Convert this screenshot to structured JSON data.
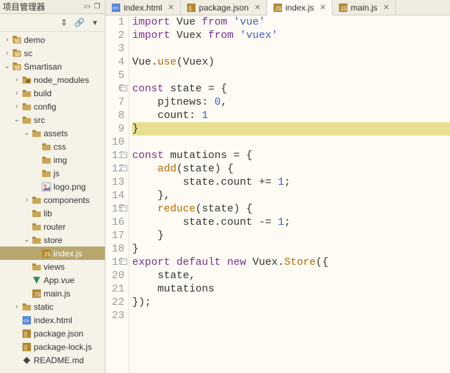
{
  "sidebar": {
    "title": "项目管理器",
    "toolbar": {
      "collapse": "⇕",
      "link": "🔗",
      "menu": "▾"
    },
    "win": {
      "min": "▭",
      "max": "❐",
      "close": "✕"
    }
  },
  "tree": [
    {
      "d": 0,
      "caret": "›",
      "icon": "project",
      "label": "demo"
    },
    {
      "d": 0,
      "caret": "›",
      "icon": "project",
      "label": "sc"
    },
    {
      "d": 0,
      "caret": "⌄",
      "icon": "project",
      "label": "Smartisan"
    },
    {
      "d": 1,
      "caret": "›",
      "icon": "pkg",
      "label": "node_modules"
    },
    {
      "d": 1,
      "caret": "›",
      "icon": "fld",
      "label": "build"
    },
    {
      "d": 1,
      "caret": "›",
      "icon": "fld",
      "label": "config"
    },
    {
      "d": 1,
      "caret": "⌄",
      "icon": "fld",
      "label": "src"
    },
    {
      "d": 2,
      "caret": "⌄",
      "icon": "fld",
      "label": "assets"
    },
    {
      "d": 3,
      "caret": " ",
      "icon": "fld",
      "label": "css"
    },
    {
      "d": 3,
      "caret": " ",
      "icon": "fld",
      "label": "img"
    },
    {
      "d": 3,
      "caret": " ",
      "icon": "fld",
      "label": "js"
    },
    {
      "d": 3,
      "caret": " ",
      "icon": "png",
      "label": "logo.png"
    },
    {
      "d": 2,
      "caret": "›",
      "icon": "fld",
      "label": "components"
    },
    {
      "d": 2,
      "caret": " ",
      "icon": "fld",
      "label": "lib"
    },
    {
      "d": 2,
      "caret": " ",
      "icon": "fld",
      "label": "router"
    },
    {
      "d": 2,
      "caret": "⌄",
      "icon": "fld",
      "label": "store"
    },
    {
      "d": 3,
      "caret": " ",
      "icon": "js",
      "label": "index.js",
      "selected": true
    },
    {
      "d": 2,
      "caret": " ",
      "icon": "fld",
      "label": "views"
    },
    {
      "d": 2,
      "caret": " ",
      "icon": "vue",
      "label": "App.vue"
    },
    {
      "d": 2,
      "caret": " ",
      "icon": "js",
      "label": "main.js"
    },
    {
      "d": 1,
      "caret": "›",
      "icon": "fld",
      "label": "static"
    },
    {
      "d": 1,
      "caret": " ",
      "icon": "html",
      "label": "index.html"
    },
    {
      "d": 1,
      "caret": " ",
      "icon": "json",
      "label": "package.json"
    },
    {
      "d": 1,
      "caret": " ",
      "icon": "json",
      "label": "package-lock.js"
    },
    {
      "d": 1,
      "caret": " ",
      "icon": "md",
      "label": "README.md"
    }
  ],
  "tabs": [
    {
      "icon": "html",
      "label": "index.html",
      "active": false
    },
    {
      "icon": "json",
      "label": "package.json",
      "active": false
    },
    {
      "icon": "js",
      "label": "index.js",
      "active": true
    },
    {
      "icon": "js",
      "label": "main.js",
      "active": false
    }
  ],
  "code": [
    {
      "n": 1,
      "fold": "",
      "seg": [
        [
          "kw",
          "import"
        ],
        [
          "pln",
          " Vue "
        ],
        [
          "kw",
          "from"
        ],
        [
          "pln",
          " "
        ],
        [
          "str",
          "'vue'"
        ]
      ]
    },
    {
      "n": 2,
      "fold": "",
      "seg": [
        [
          "kw",
          "import"
        ],
        [
          "pln",
          " Vuex "
        ],
        [
          "kw",
          "from"
        ],
        [
          "pln",
          " "
        ],
        [
          "str",
          "'vuex'"
        ]
      ]
    },
    {
      "n": 3,
      "fold": "",
      "seg": []
    },
    {
      "n": 4,
      "fold": "",
      "seg": [
        [
          "id",
          "Vue"
        ],
        [
          "op",
          "."
        ],
        [
          "fn",
          "use"
        ],
        [
          "op",
          "("
        ],
        [
          "id",
          "Vuex"
        ],
        [
          "op",
          ")"
        ]
      ]
    },
    {
      "n": 5,
      "fold": "",
      "seg": []
    },
    {
      "n": 6,
      "fold": "−",
      "seg": [
        [
          "kw",
          "const"
        ],
        [
          "pln",
          " state "
        ],
        [
          "op",
          "= {"
        ]
      ]
    },
    {
      "n": 7,
      "fold": "",
      "seg": [
        [
          "pln",
          "    pjtnews: "
        ],
        [
          "num",
          "0"
        ],
        [
          "op",
          ","
        ]
      ]
    },
    {
      "n": 8,
      "fold": "",
      "seg": [
        [
          "pln",
          "    count: "
        ],
        [
          "num",
          "1"
        ]
      ]
    },
    {
      "n": 9,
      "fold": "",
      "hl": true,
      "seg": [
        [
          "op",
          "}"
        ]
      ]
    },
    {
      "n": 10,
      "fold": "",
      "seg": []
    },
    {
      "n": 11,
      "fold": "−",
      "seg": [
        [
          "kw",
          "const"
        ],
        [
          "pln",
          " mutations "
        ],
        [
          "op",
          "= {"
        ]
      ]
    },
    {
      "n": 12,
      "fold": "−",
      "seg": [
        [
          "pln",
          "    "
        ],
        [
          "fn",
          "add"
        ],
        [
          "op",
          "("
        ],
        [
          "id",
          "state"
        ],
        [
          "op",
          ") {"
        ]
      ]
    },
    {
      "n": 13,
      "fold": "",
      "seg": [
        [
          "pln",
          "        state"
        ],
        [
          "op",
          "."
        ],
        [
          "id",
          "count"
        ],
        [
          "pln",
          " "
        ],
        [
          "op",
          "+="
        ],
        [
          "pln",
          " "
        ],
        [
          "num",
          "1"
        ],
        [
          "op",
          ";"
        ]
      ]
    },
    {
      "n": 14,
      "fold": "",
      "seg": [
        [
          "pln",
          "    "
        ],
        [
          "op",
          "},"
        ]
      ]
    },
    {
      "n": 15,
      "fold": "−",
      "seg": [
        [
          "pln",
          "    "
        ],
        [
          "fn",
          "reduce"
        ],
        [
          "op",
          "("
        ],
        [
          "id",
          "state"
        ],
        [
          "op",
          ") {"
        ]
      ]
    },
    {
      "n": 16,
      "fold": "",
      "seg": [
        [
          "pln",
          "        state"
        ],
        [
          "op",
          "."
        ],
        [
          "id",
          "count"
        ],
        [
          "pln",
          " "
        ],
        [
          "op",
          "-="
        ],
        [
          "pln",
          " "
        ],
        [
          "num",
          "1"
        ],
        [
          "op",
          ";"
        ]
      ]
    },
    {
      "n": 17,
      "fold": "",
      "seg": [
        [
          "pln",
          "    "
        ],
        [
          "op",
          "}"
        ]
      ]
    },
    {
      "n": 18,
      "fold": "",
      "seg": [
        [
          "op",
          "}"
        ]
      ]
    },
    {
      "n": 19,
      "fold": "−",
      "seg": [
        [
          "kw",
          "export"
        ],
        [
          "pln",
          " "
        ],
        [
          "kw",
          "default"
        ],
        [
          "pln",
          " "
        ],
        [
          "kw",
          "new"
        ],
        [
          "pln",
          " Vuex"
        ],
        [
          "op",
          "."
        ],
        [
          "fn",
          "Store"
        ],
        [
          "op",
          "({"
        ]
      ]
    },
    {
      "n": 20,
      "fold": "",
      "seg": [
        [
          "pln",
          "    state"
        ],
        [
          "op",
          ","
        ]
      ]
    },
    {
      "n": 21,
      "fold": "",
      "seg": [
        [
          "pln",
          "    mutations"
        ]
      ]
    },
    {
      "n": 22,
      "fold": "",
      "seg": [
        [
          "op",
          "});"
        ]
      ]
    },
    {
      "n": 23,
      "fold": "",
      "seg": []
    }
  ]
}
